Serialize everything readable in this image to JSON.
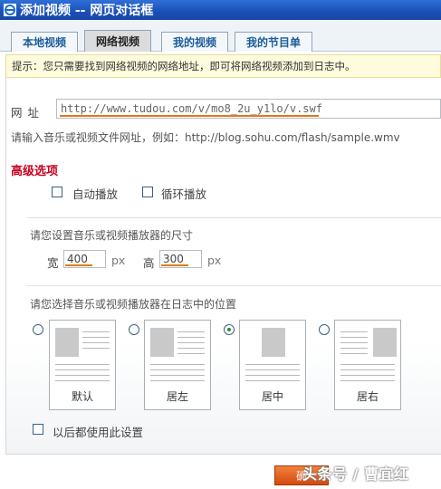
{
  "window": {
    "title": "添加视频 -- 网页对话框"
  },
  "tabs": [
    {
      "label": "本地视频",
      "active": false
    },
    {
      "label": "网络视频",
      "active": true
    },
    {
      "label": "我的视频",
      "active": false
    },
    {
      "label": "我的节目单",
      "active": false
    }
  ],
  "hint": "提示：您只需要找到网络视频的网络地址，即可将网络视频添加到日志中。",
  "url": {
    "label": "网址",
    "value": "http://www.tudou.com/v/mo8_2u_y1lo/v.swf",
    "example": "请输入音乐或视频文件网址，例如：http://blog.sohu.com/flash/sample.wmv"
  },
  "advanced": {
    "title": "高级选项",
    "autoplay_label": "自动播放",
    "loop_label": "循环播放"
  },
  "size": {
    "title": "请您设置音乐或视频播放器的尺寸",
    "width_label": "宽",
    "width_value": "400",
    "height_label": "高",
    "height_value": "300",
    "unit": "px"
  },
  "position": {
    "title": "请您选择音乐或视频播放器在日志中的位置",
    "options": [
      {
        "label": "默认",
        "checked": false
      },
      {
        "label": "居左",
        "checked": false
      },
      {
        "label": "居中",
        "checked": true
      },
      {
        "label": "居右",
        "checked": false
      }
    ],
    "remember_label": "以后都使用此设置"
  },
  "footer": {
    "confirm_label": "确",
    "watermark": "头条号 / 曹宜红"
  },
  "colors": {
    "accent_underline": "#e07a17",
    "advanced_title": "#c8001e",
    "titlebar": "#1a4fb8"
  }
}
